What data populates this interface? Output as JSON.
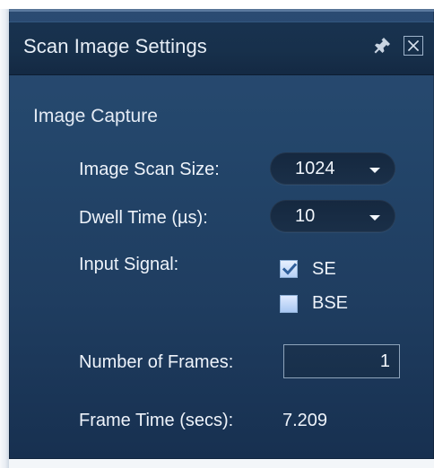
{
  "window": {
    "title": "Scan Image Settings",
    "pin_icon": "pin-icon",
    "close_icon": "close-icon"
  },
  "image_capture": {
    "section_title": "Image Capture",
    "image_scan_size": {
      "label": "Image Scan Size:",
      "value": "1024"
    },
    "dwell_time": {
      "label": "Dwell Time (µs):",
      "value": "10"
    },
    "input_signal": {
      "label": "Input Signal:",
      "options": [
        {
          "label": "SE",
          "checked": true
        },
        {
          "label": "BSE",
          "checked": false
        }
      ]
    },
    "number_of_frames": {
      "label": "Number of Frames:",
      "value": "1"
    },
    "frame_time": {
      "label": "Frame Time (secs):",
      "value": "7.209"
    }
  },
  "colors": {
    "panel_background": "#24476c",
    "title_bar_background": "#17304b",
    "text": "#eef3fa",
    "checkbox_fill": "#b7d0f5",
    "check_mark": "#2f5f9b"
  }
}
